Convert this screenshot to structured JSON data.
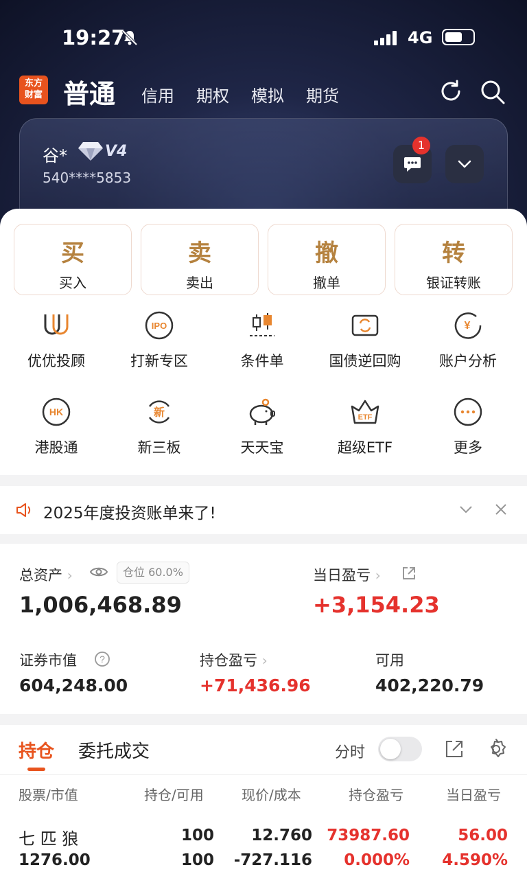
{
  "status_bar": {
    "time": "19:27",
    "network": "4G"
  },
  "nav": {
    "logo_line1": "东方",
    "logo_line2": "财富",
    "tabs": [
      "普通",
      "信用",
      "期权",
      "模拟",
      "期货"
    ]
  },
  "account": {
    "name": "谷*",
    "level": "V4",
    "number": "540****5853",
    "message_badge": "1"
  },
  "trade_buttons": [
    {
      "icon_char": "买",
      "label": "买入"
    },
    {
      "icon_char": "卖",
      "label": "卖出"
    },
    {
      "icon_char": "撤",
      "label": "撤单"
    },
    {
      "icon_char": "转",
      "label": "银证转账"
    }
  ],
  "functions": [
    {
      "label": "优优投顾",
      "icon": "youyou-advisor-icon"
    },
    {
      "label": "打新专区",
      "icon": "ipo-icon",
      "icon_text": "IPO"
    },
    {
      "label": "条件单",
      "icon": "candlestick-icon"
    },
    {
      "label": "国债逆回购",
      "icon": "bond-repo-icon"
    },
    {
      "label": "账户分析",
      "icon": "account-analysis-icon",
      "icon_text": "¥"
    },
    {
      "label": "港股通",
      "icon": "hk-icon",
      "icon_text": "HK"
    },
    {
      "label": "新三板",
      "icon": "neeq-icon",
      "icon_text": "新"
    },
    {
      "label": "天天宝",
      "icon": "piggy-bank-icon"
    },
    {
      "label": "超级ETF",
      "icon": "etf-icon",
      "icon_text": "ETF"
    },
    {
      "label": "更多",
      "icon": "more-icon"
    }
  ],
  "notice": {
    "text": "2025年度投资账单来了!"
  },
  "assets": {
    "total_label": "总资产",
    "position_ratio": "仓位 60.0%",
    "total_value": "1,006,468.89",
    "daily_pl_label": "当日盈亏",
    "daily_pl_value": "+3,154.23",
    "market_value_label": "证券市值",
    "market_value": "604,248.00",
    "holding_pl_label": "持仓盈亏",
    "holding_pl_value": "+71,436.96",
    "available_label": "可用",
    "available_value": "402,220.79"
  },
  "holdings": {
    "tab_active": "持仓",
    "tab_other": "委托成交",
    "timeshare_label": "分时",
    "columns": [
      "股票/市值",
      "持仓/可用",
      "现价/成本",
      "持仓盈亏",
      "当日盈亏"
    ],
    "rows": [
      {
        "name": "七 匹 狼",
        "market_value": "1276.00",
        "position": "100",
        "available": "100",
        "price": "12.760",
        "cost": "-727.116",
        "holding_pl": "73987.60",
        "holding_pl_pct": "0.000%",
        "daily_pl": "56.00",
        "daily_pl_pct": "4.590%"
      }
    ]
  },
  "colors": {
    "accent": "#e8541e",
    "gold": "#b5823f",
    "up_red": "#e5322d"
  }
}
